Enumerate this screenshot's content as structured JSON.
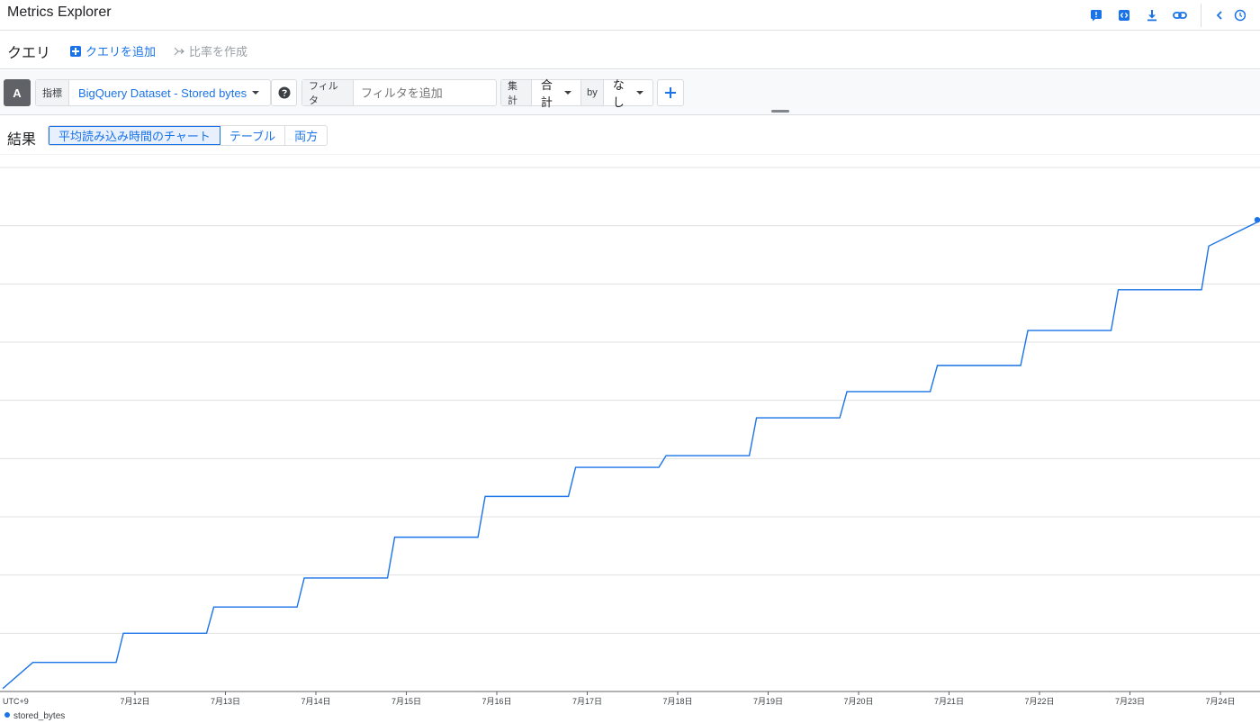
{
  "header": {
    "title": "Metrics Explorer"
  },
  "query_bar": {
    "label": "クエリ",
    "add_query": "クエリを追加",
    "create_ratio": "比率を作成"
  },
  "builder": {
    "query_letter": "A",
    "metric_label": "指標",
    "metric_value": "BigQuery Dataset - Stored bytes",
    "filter_label": "フィルタ",
    "filter_placeholder": "フィルタを追加",
    "aggregation_label": "集計",
    "aggregation_value": "合計",
    "by_label": "by",
    "group_value": "なし"
  },
  "results": {
    "label": "結果",
    "tabs": [
      {
        "label": "平均読み込み時間のチャート",
        "active": true
      },
      {
        "label": "テーブル",
        "active": false
      },
      {
        "label": "両方",
        "active": false
      }
    ]
  },
  "colors": {
    "accent": "#1a73e8",
    "series": "#1a73e8",
    "grid": "#e0e0e0"
  },
  "chart_data": {
    "type": "line",
    "step": true,
    "timezone_label": "UTC+9",
    "x_tick_labels": [
      "7月12日",
      "7月13日",
      "7月14日",
      "7月15日",
      "7月16日",
      "7月17日",
      "7月18日",
      "7月19日",
      "7月20日",
      "7月21日",
      "7月22日",
      "7月23日",
      "7月24日"
    ],
    "xlim": [
      "7月10日 19:00",
      "7月24日 11:00"
    ],
    "ylim": [
      0,
      9
    ],
    "grid": true,
    "legend_position": "bottom-left",
    "series": [
      {
        "name": "stored_bytes",
        "x": [
          "7月10日 19:00",
          "7月11日 19:00",
          "7月12日 19:00",
          "7月13日 19:00",
          "7月14日 19:00",
          "7月15日 19:00",
          "7月16日 19:00",
          "7月17日 19:00",
          "7月18日 19:00",
          "7月19日 19:00",
          "7月20日 19:00",
          "7月21日 19:00",
          "7月22日 19:00",
          "7月23日 19:00",
          "7月24日 11:00"
        ],
        "values": [
          0.5,
          1.0,
          1.45,
          1.95,
          2.65,
          3.35,
          3.85,
          4.05,
          4.7,
          5.15,
          5.6,
          6.2,
          6.9,
          7.65,
          8.1
        ]
      }
    ]
  }
}
